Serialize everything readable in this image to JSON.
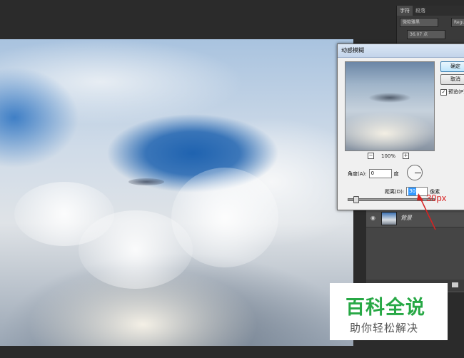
{
  "right_panel": {
    "tabs": [
      "字符",
      "段落"
    ],
    "font_name": "微软雅黑",
    "font_style": "Regu",
    "font_size": "36.07 点"
  },
  "layers": {
    "layer_name": "背景"
  },
  "dialog": {
    "title": "动感模糊",
    "ok_label": "确定",
    "cancel_label": "取消",
    "preview_label": "预览(P)",
    "preview_checked": true,
    "zoom_level": "100%",
    "zoom_out": "−",
    "zoom_in": "+",
    "angle_label": "角度(A):",
    "angle_value": "0",
    "angle_unit": "度",
    "distance_label": "距离(D):",
    "distance_value": "30",
    "distance_unit": "像素",
    "slider_value_fraction": 0.06
  },
  "annotation": {
    "text": "30px",
    "color": "#d92121"
  },
  "watermark": {
    "title": "百科全说",
    "subtitle": "助你轻松解决",
    "title_color": "#27a845"
  }
}
